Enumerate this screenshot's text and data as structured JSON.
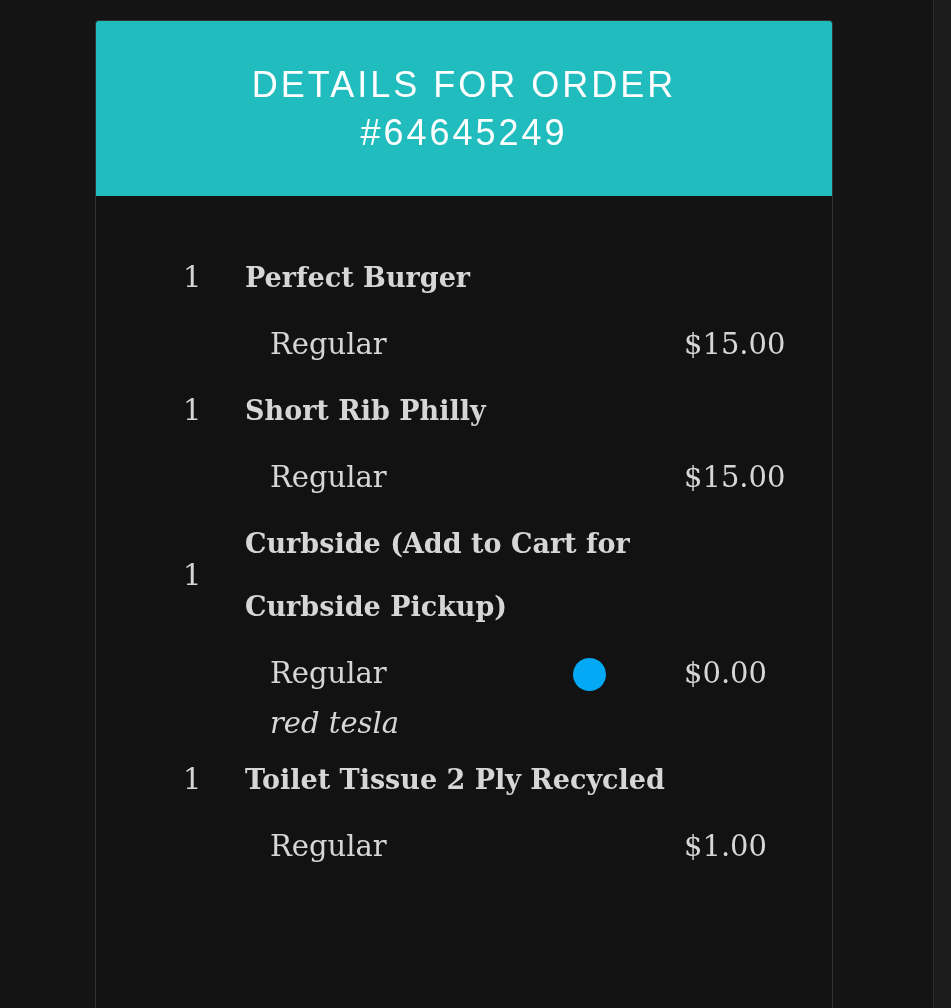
{
  "order": {
    "title": "DETAILS FOR ORDER #64645249"
  },
  "items": [
    {
      "quantity": "1",
      "name": "Perfect Burger",
      "variant": "Regular",
      "price": "$15.00"
    },
    {
      "quantity": "1",
      "name": "Short Rib Philly",
      "variant": "Regular",
      "price": "$15.00"
    },
    {
      "quantity": "1",
      "name": "Curbside (Add to Cart for Curbside Pickup)",
      "variant": "Regular",
      "price": "$0.00",
      "note": "red tesla"
    },
    {
      "quantity": "1",
      "name": "Toilet Tissue 2 Ply Recycled",
      "variant": "Regular",
      "price": "$1.00"
    }
  ],
  "touch_indicator": true
}
